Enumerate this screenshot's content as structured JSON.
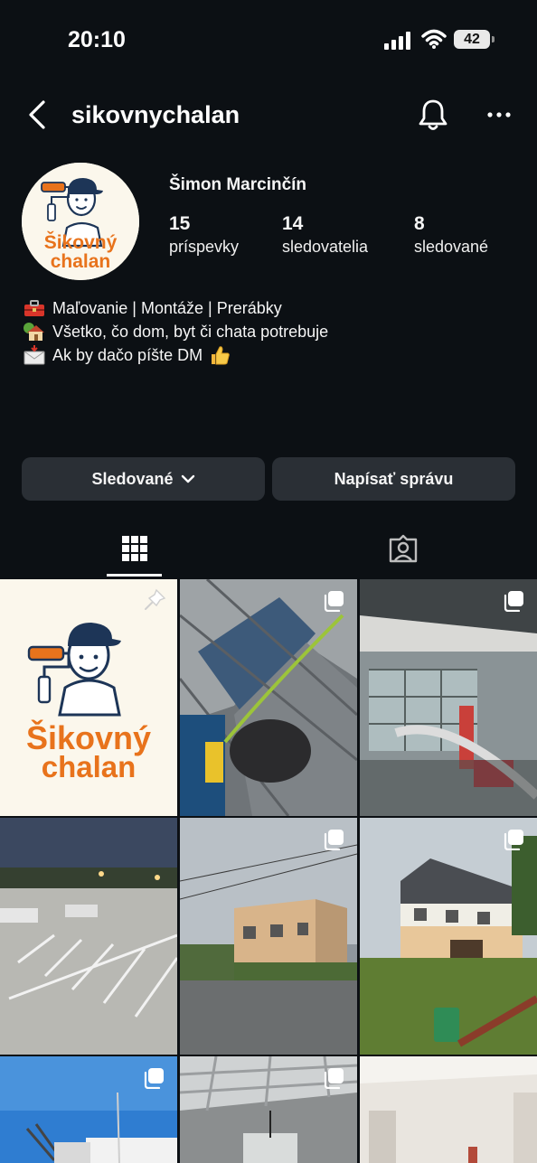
{
  "status_bar": {
    "time": "20:10",
    "battery": "42"
  },
  "header": {
    "username": "sikovnychalan"
  },
  "profile": {
    "full_name": "Šimon Marcinčín",
    "avatar_text_line1": "Šikovný",
    "avatar_text_line2": "chalan",
    "stats": [
      {
        "value": "15",
        "label": "príspevky"
      },
      {
        "value": "14",
        "label": "sledovatelia"
      },
      {
        "value": "8",
        "label": "sledované"
      }
    ],
    "bio": [
      {
        "icon": "toolbox-icon",
        "text": "Maľovanie | Montáže | Prerábky"
      },
      {
        "icon": "house-icon",
        "text": "Všetko, čo dom, byt či chata potrebuje"
      },
      {
        "icon": "envelope-icon",
        "text": "Ak by dačo píšte DM"
      }
    ]
  },
  "actions": {
    "following_label": "Sledované",
    "message_label": "Napísať správu"
  },
  "tabs": [
    {
      "icon": "grid-icon"
    },
    {
      "icon": "tagged-icon"
    }
  ],
  "posts": [
    {
      "kind": "logo",
      "text_line1": "Šikovný",
      "text_line2": "chalan",
      "pinned": true
    },
    {
      "kind": "photo-worker-scaffold",
      "multi": true
    },
    {
      "kind": "photo-workshop-interior",
      "multi": true
    },
    {
      "kind": "photo-parking-lot",
      "multi": false
    },
    {
      "kind": "photo-house-street",
      "multi": true
    },
    {
      "kind": "photo-house-garden",
      "multi": true
    },
    {
      "kind": "photo-crane-building",
      "multi": true
    },
    {
      "kind": "photo-ceiling-room",
      "multi": true
    },
    {
      "kind": "photo-white-room",
      "multi": false
    }
  ],
  "colors": {
    "background": "#0c1014",
    "button": "#2a2f35",
    "brand_orange": "#e8731c",
    "brand_navy": "#1d3557"
  }
}
